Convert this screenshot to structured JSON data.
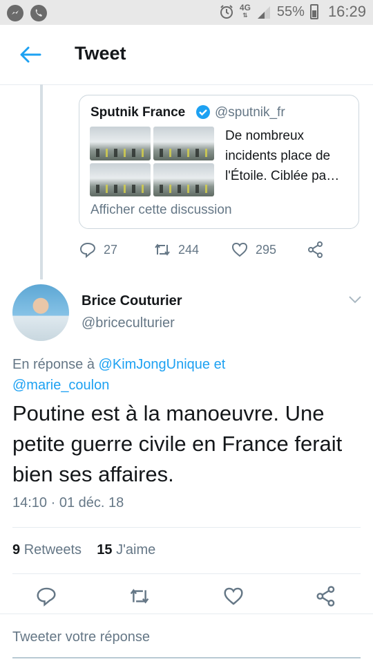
{
  "status_bar": {
    "network": "4G",
    "battery": "55%",
    "time": "16:29"
  },
  "header": {
    "title": "Tweet"
  },
  "quoted_tweet": {
    "author_name": "Sputnik France",
    "author_handle": "@sputnik_fr",
    "text": "De nombreux incidents place de l'Étoile. Ciblée pa…",
    "show_thread": "Afficher cette discussion",
    "replies": "27",
    "retweets": "244",
    "likes": "295"
  },
  "tweet": {
    "author_name": "Brice Couturier",
    "author_handle": "@briceculturier",
    "reply_prefix": "En réponse à",
    "mention_1": "@KimJongUnique",
    "reply_join": "et",
    "mention_2": "@marie_coulon",
    "text": "Poutine est à la manoeuvre. Une petite guerre civile en France ferait bien ses affaires.",
    "timestamp": "14:10 · 01 déc. 18",
    "retweet_count": "9",
    "retweet_label": "Retweets",
    "like_count": "15",
    "like_label": "J'aime"
  },
  "reply_box": {
    "placeholder": "Tweeter votre réponse"
  },
  "colors": {
    "accent": "#1da1f2",
    "muted": "#657786",
    "text": "#14171a"
  }
}
